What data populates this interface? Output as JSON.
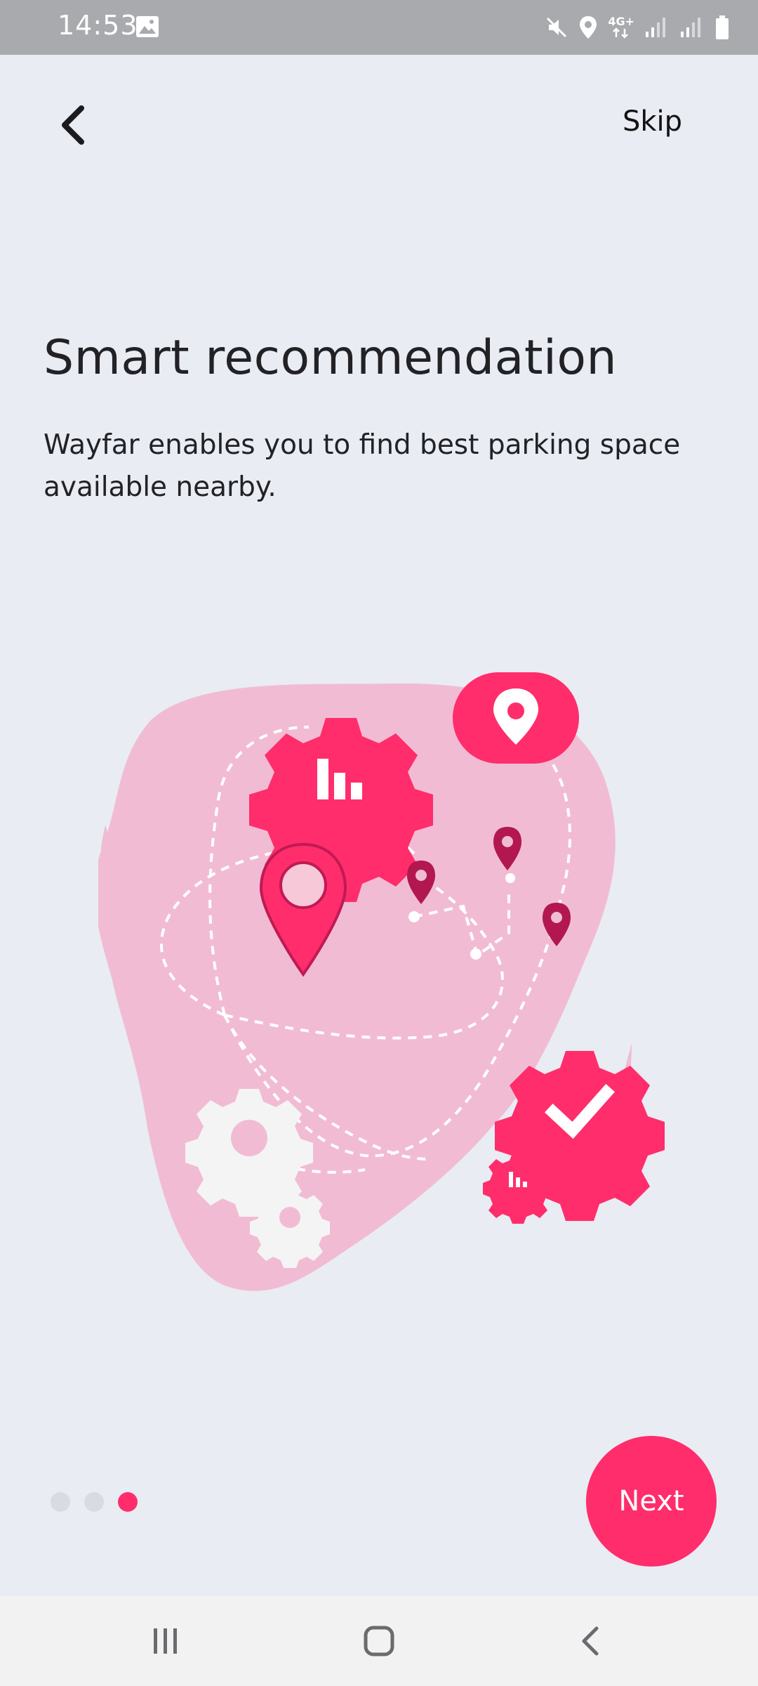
{
  "status_bar": {
    "time": "14:53",
    "network": "4G+",
    "icons": [
      "image-icon",
      "mute-icon",
      "location-icon",
      "network-icon",
      "signal-icon",
      "signal-icon",
      "battery-icon"
    ]
  },
  "header": {
    "back_icon": "chevron-left-icon",
    "skip_label": "Skip"
  },
  "content": {
    "title": "Smart recommendation",
    "description": "Wayfar enables you to find best parking space available nearby."
  },
  "pager": {
    "total": 3,
    "active_index": 2
  },
  "footer": {
    "next_label": "Next"
  },
  "nav_bar": {
    "items": [
      "recent-apps-icon",
      "home-icon",
      "back-icon"
    ]
  },
  "colors": {
    "accent": "#ff2d6b",
    "background": "#e9ecf3",
    "blob": "#f1bcd3",
    "dark_pin": "#b3174f",
    "status_bar": "#a9aaad"
  }
}
